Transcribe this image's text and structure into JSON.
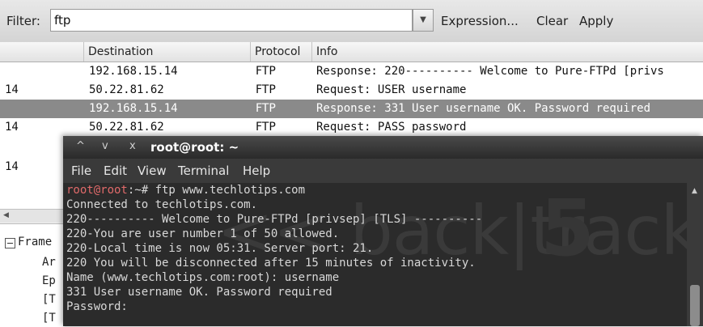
{
  "filter": {
    "label": "Filter:",
    "value": "ftp",
    "buttons": [
      "Expression...",
      "Clear",
      "Apply"
    ]
  },
  "packet_list": {
    "columns": [
      "Destination",
      "Protocol",
      "Info"
    ],
    "rows": [
      {
        "source": "",
        "destination": "192.168.15.14",
        "protocol": "FTP",
        "info": "Response: 220---------- Welcome to Pure-FTPd [privs"
      },
      {
        "source": "14",
        "destination": "50.22.81.62",
        "protocol": "FTP",
        "info": "Request: USER username"
      },
      {
        "source": "",
        "destination": "192.168.15.14",
        "protocol": "FTP",
        "info": "Response: 331 User username OK. Password required"
      },
      {
        "source": "14",
        "destination": "50.22.81.62",
        "protocol": "FTP",
        "info": "Request: PASS password"
      },
      {
        "source": "",
        "destination": "",
        "protocol": "",
        "info": ""
      },
      {
        "source": "14",
        "destination": "",
        "protocol": "",
        "info": ""
      },
      {
        "source": "",
        "destination": "",
        "protocol": "",
        "info": ""
      }
    ],
    "selected_row": 2
  },
  "details": {
    "items": [
      "Frame",
      "Ar",
      "Ep",
      "[T",
      "[T"
    ]
  },
  "terminal": {
    "title": "root@root: ~",
    "controls": [
      "^",
      "v",
      "x"
    ],
    "menu": [
      "File",
      "Edit",
      "View",
      "Terminal",
      "Help"
    ],
    "prompt": "root@root",
    "command": ":~# ftp www.techlotips.com",
    "lines": [
      "Connected to techlotips.com.",
      "220---------- Welcome to Pure-FTPd [privsep] [TLS] ----------",
      "220-You are user number 1 of 50 allowed.",
      "220-Local time is now 05:31. Server port: 21.",
      "220 You will be disconnected after 15 minutes of inactivity.",
      "Name (www.techlotips.com:root): username",
      "331 User username OK. Password required",
      "Password:"
    ],
    "watermark": "<< back|track",
    "watermark_number": "5"
  }
}
